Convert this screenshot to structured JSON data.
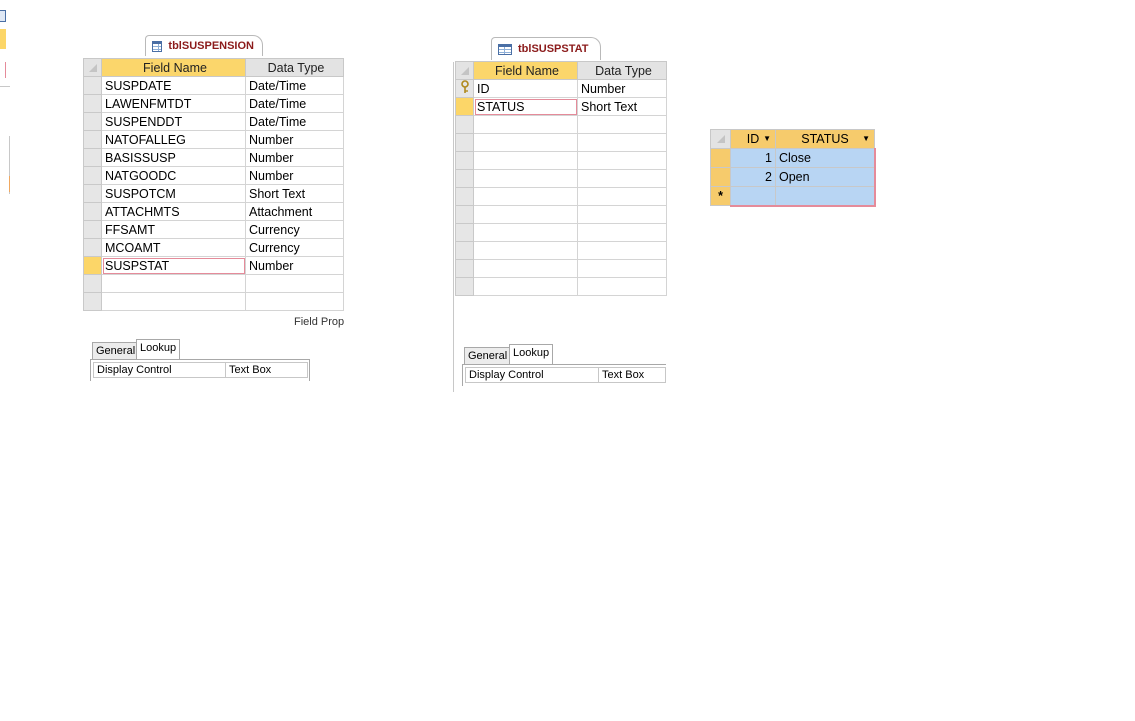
{
  "tables": [
    {
      "tab_title": "tblSUSPENSION",
      "columns": [
        "Field Name",
        "Data Type"
      ],
      "rows": [
        {
          "field": "SUSPDATE",
          "type": "Date/Time"
        },
        {
          "field": "LAWENFMTDT",
          "type": "Date/Time"
        },
        {
          "field": "SUSPENDDT",
          "type": "Date/Time"
        },
        {
          "field": "NATOFALLEG",
          "type": "Number"
        },
        {
          "field": "BASISSUSP",
          "type": "Number"
        },
        {
          "field": "NATGOODC",
          "type": "Number"
        },
        {
          "field": "SUSPOTCM",
          "type": "Short Text"
        },
        {
          "field": "ATTACHMTS",
          "type": "Attachment"
        },
        {
          "field": "FFSAMT",
          "type": "Currency"
        },
        {
          "field": "MCOAMT",
          "type": "Currency"
        },
        {
          "field": "SUSPSTAT",
          "type": "Number"
        }
      ],
      "field_props_label": "Field Prop",
      "prop_tabs": [
        "General",
        "Lookup"
      ],
      "prop_row": {
        "name": "Display Control",
        "value": "Text Box"
      }
    },
    {
      "tab_title": "tblSUSPSTAT",
      "columns": [
        "Field Name",
        "Data Type"
      ],
      "rows": [
        {
          "field": "ID",
          "type": "Number"
        },
        {
          "field": "STATUS",
          "type": "Short Text"
        }
      ],
      "prop_tabs": [
        "General",
        "Lookup"
      ],
      "prop_row": {
        "name": "Display Control",
        "value": "Text Box"
      }
    }
  ],
  "datasheet": {
    "columns": [
      "ID",
      "STATUS"
    ],
    "rows": [
      {
        "id": "1",
        "status": "Close"
      },
      {
        "id": "2",
        "status": "Open"
      }
    ],
    "new_row_marker": "*"
  },
  "icons": [
    "table-icon",
    "primary-key-icon",
    "dropdown-arrow-icon"
  ],
  "colors": {
    "selector_gold": "#fcd668",
    "tab_title": "#8b1a1a",
    "selection_blue": "#b8d5f3",
    "current_cell_border": "#e58b9a"
  }
}
